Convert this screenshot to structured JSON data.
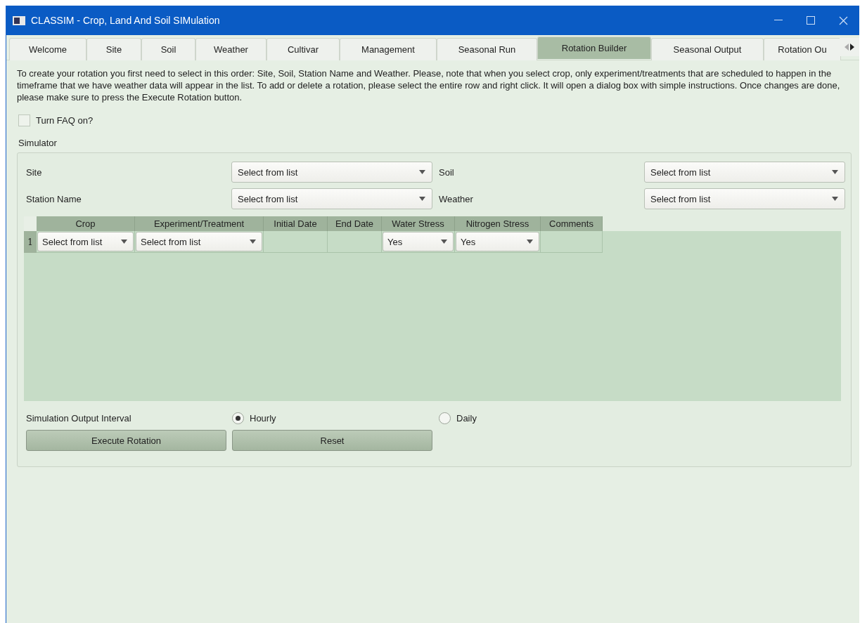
{
  "window": {
    "title": "CLASSIM - Crop, Land And Soil SIMulation"
  },
  "tabs": [
    {
      "label": "Welcome",
      "selected": false
    },
    {
      "label": "Site",
      "selected": false
    },
    {
      "label": "Soil",
      "selected": false
    },
    {
      "label": "Weather",
      "selected": false
    },
    {
      "label": "Cultivar",
      "selected": false
    },
    {
      "label": "Management",
      "selected": false
    },
    {
      "label": "Seasonal Run",
      "selected": false
    },
    {
      "label": "Rotation Builder",
      "selected": true
    },
    {
      "label": "Seasonal Output",
      "selected": false
    },
    {
      "label": "Rotation Ou",
      "selected": false
    }
  ],
  "instructions": "To create your rotation you first need to select in this order: Site, Soil, Station Name and Weather. Please, note that when you select crop, only experiment/treatments that are scheduled to happen in the timeframe that we have weather data will appear in the list. To add or delete a rotation, please select the entire row and right click. It will open a dialog box with simple instructions. Once changes are done, please make sure to press the Execute Rotation button.",
  "faq_checkbox": {
    "label": "Turn FAQ on?",
    "checked": false
  },
  "simulator": {
    "title": "Simulator",
    "fields": [
      {
        "label": "Site",
        "value": "Select from list"
      },
      {
        "label": "Soil",
        "value": "Select from list"
      },
      {
        "label": "Station Name",
        "value": "Select from list"
      },
      {
        "label": "Weather",
        "value": "Select from list"
      }
    ],
    "table": {
      "columns": [
        "Crop",
        "Experiment/Treatment",
        "Initial Date",
        "End Date",
        "Water Stress",
        "Nitrogen Stress",
        "Comments"
      ],
      "rows": [
        {
          "number": "1",
          "cells": [
            {
              "kind": "dropdown",
              "value": "Select from list"
            },
            {
              "kind": "dropdown",
              "value": "Select from list"
            },
            {
              "kind": "blank"
            },
            {
              "kind": "blank"
            },
            {
              "kind": "dropdown",
              "value": "Yes"
            },
            {
              "kind": "dropdown",
              "value": "Yes"
            },
            {
              "kind": "blank"
            }
          ]
        }
      ]
    },
    "output_interval": {
      "label": "Simulation Output Interval",
      "options": [
        {
          "label": "Hourly",
          "selected": true
        },
        {
          "label": "Daily",
          "selected": false
        }
      ]
    },
    "buttons": [
      "Execute Rotation",
      "Reset"
    ]
  }
}
